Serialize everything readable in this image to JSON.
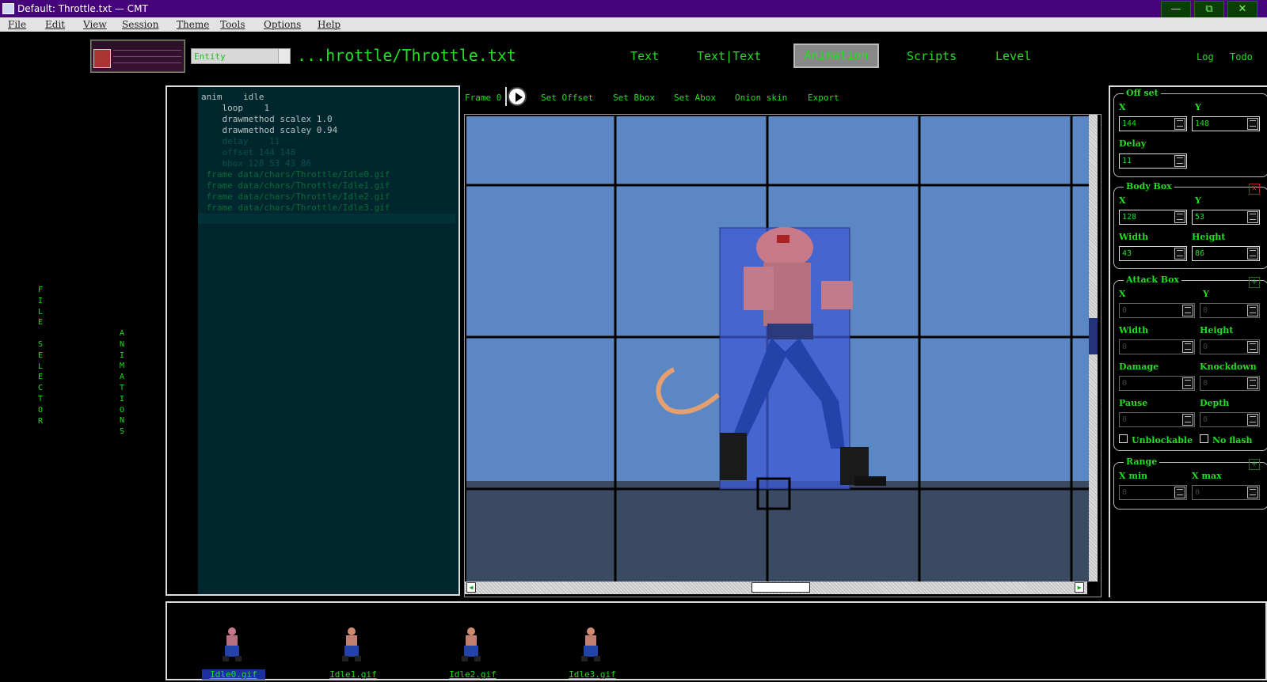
{
  "window": {
    "title": "Default: Throttle.txt — CMT",
    "controls": [
      "—",
      "⧉",
      "✕"
    ]
  },
  "menu": [
    "File",
    "Edit",
    "View",
    "Session",
    "Theme",
    "Tools",
    "Options",
    "Help"
  ],
  "header": {
    "entity_select": "Entity",
    "file_path": "...hrottle/Throttle.txt",
    "tabs": [
      "Text",
      "Text|Text",
      "Animation",
      "Scripts",
      "Level"
    ],
    "active_tab": "Animation",
    "links": [
      "Log",
      "Todo"
    ]
  },
  "side_labels": {
    "file_selector": "FILE SELECTOR",
    "animations": "ANIMATIONS"
  },
  "editor": {
    "lines": [
      "anim    idle",
      "    loop    1",
      "    drawmethod scalex 1.0",
      "    drawmethod scaley 0.94",
      "    delay    11",
      "    offset 144 148",
      "    bbox 128 53 43 86",
      " frame data/chars/Throttle/Idle0.gif",
      " frame data/chars/Throttle/Idle1.gif",
      " frame data/chars/Throttle/Idle2.gif",
      " frame data/chars/Throttle/Idle3.gif"
    ]
  },
  "anim_toolbar": {
    "frame_label": "Frame 0",
    "actions": [
      "Set Offset",
      "Set Bbox",
      "Set Abox",
      "Onion skin",
      "Export"
    ]
  },
  "properties": {
    "offset": {
      "title": "Off set",
      "x_label": "X",
      "y_label": "Y",
      "x": "144",
      "y": "148",
      "delay_label": "Delay",
      "delay": "11"
    },
    "body_box": {
      "title": "Body Box",
      "x_label": "X",
      "y_label": "Y",
      "x": "128",
      "y": "53",
      "width_label": "Width",
      "height_label": "Height",
      "width": "43",
      "height": "86",
      "remove": "×"
    },
    "attack_box": {
      "title": "Attack Box",
      "add": "+",
      "x_label": "X",
      "y_label": "Y",
      "x": "0",
      "y": "0",
      "width_label": "Width",
      "height_label": "Height",
      "width": "0",
      "height": "0",
      "damage_label": "Damage",
      "knockdown_label": "Knockdown",
      "damage": "0",
      "knockdown": "0",
      "pause_label": "Pause",
      "depth_label": "Depth",
      "pause": "0",
      "depth": "0",
      "unblockable_label": "Unblockable",
      "noflash_label": "No flash"
    },
    "range": {
      "title": "Range",
      "add": "+",
      "xmin_label": "X min",
      "xmax_label": "X max",
      "xmin": "0",
      "xmax": "0"
    }
  },
  "frames": [
    {
      "name": "Idle0.gif",
      "selected": true
    },
    {
      "name": "Idle1.gif",
      "selected": false
    },
    {
      "name": "Idle2.gif",
      "selected": false
    },
    {
      "name": "Idle3.gif",
      "selected": false
    }
  ],
  "colors": {
    "title_bar": "#46047a",
    "accent_green": "#22dd22",
    "editor_bg": "#00262e",
    "stage_bg": "#5b88c4",
    "bbox_fill": "#3d5bd6"
  }
}
